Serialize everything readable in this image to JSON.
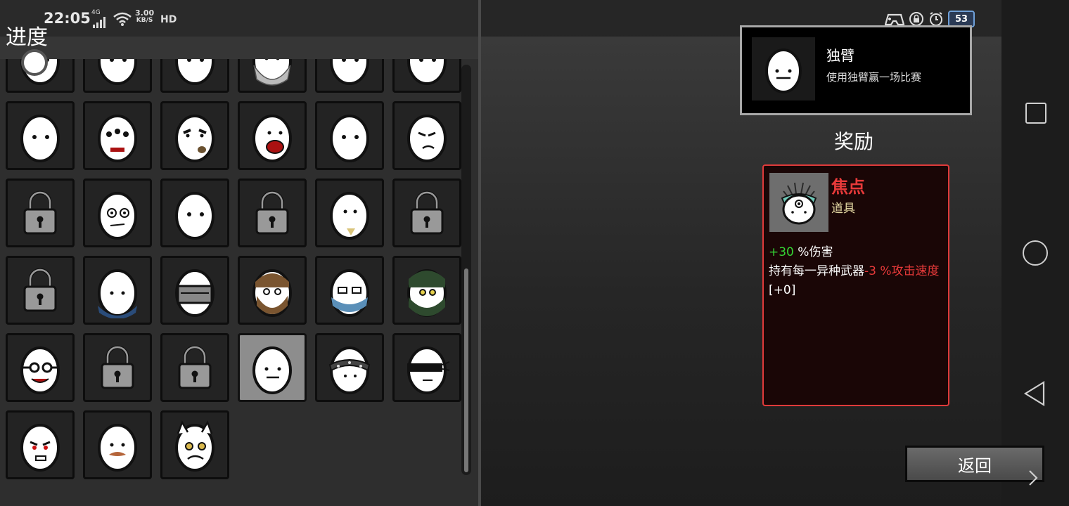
{
  "status_bar": {
    "time": "22:05",
    "network": "4G",
    "speed_value": "3.00",
    "speed_unit": "KB/S",
    "hd": "HD",
    "battery": "53",
    "icons": [
      "controller-icon",
      "lock-icon",
      "alarm-icon"
    ]
  },
  "page": {
    "title": "进度"
  },
  "character_grid": {
    "selected_index": 27,
    "cells": [
      {
        "type": "face",
        "face": "plain"
      },
      {
        "type": "face",
        "face": "plain"
      },
      {
        "type": "face",
        "face": "plain"
      },
      {
        "type": "face",
        "face": "beard-old"
      },
      {
        "type": "face",
        "face": "plain"
      },
      {
        "type": "face",
        "face": "plain"
      },
      {
        "type": "face",
        "face": "plain"
      },
      {
        "type": "face",
        "face": "multi-eyes"
      },
      {
        "type": "face",
        "face": "brow"
      },
      {
        "type": "face",
        "face": "open-mouth"
      },
      {
        "type": "face",
        "face": "plain"
      },
      {
        "type": "face",
        "face": "sad"
      },
      {
        "type": "locked"
      },
      {
        "type": "face",
        "face": "wide-eyes"
      },
      {
        "type": "face",
        "face": "plain"
      },
      {
        "type": "locked"
      },
      {
        "type": "face",
        "face": "goatee"
      },
      {
        "type": "locked"
      },
      {
        "type": "locked"
      },
      {
        "type": "face",
        "face": "collar"
      },
      {
        "type": "face",
        "face": "helmet"
      },
      {
        "type": "face",
        "face": "hairy"
      },
      {
        "type": "face",
        "face": "glasses-mask"
      },
      {
        "type": "face",
        "face": "ninja"
      },
      {
        "type": "face",
        "face": "goggles"
      },
      {
        "type": "locked"
      },
      {
        "type": "locked"
      },
      {
        "type": "face",
        "face": "one-arm"
      },
      {
        "type": "face",
        "face": "spikes"
      },
      {
        "type": "face",
        "face": "blindfold"
      },
      {
        "type": "face",
        "face": "angry"
      },
      {
        "type": "face",
        "face": "mustache"
      },
      {
        "type": "face",
        "face": "horned"
      }
    ]
  },
  "achievement": {
    "name": "独臂",
    "description": "使用独臂赢一场比赛"
  },
  "reward": {
    "title": "奖励",
    "item_name": "焦点",
    "item_type": "道具",
    "stat1_value": "+30",
    "stat1_label": " %伤害",
    "stat2_prefix": "持有每一异种武器",
    "stat2_value": "-3 %攻击速度",
    "stat2_suffix": " [+0]"
  },
  "buttons": {
    "back": "返回"
  },
  "colors": {
    "reward_border": "#e03a3a",
    "positive": "#35d535",
    "negative": "#e83a3a"
  }
}
